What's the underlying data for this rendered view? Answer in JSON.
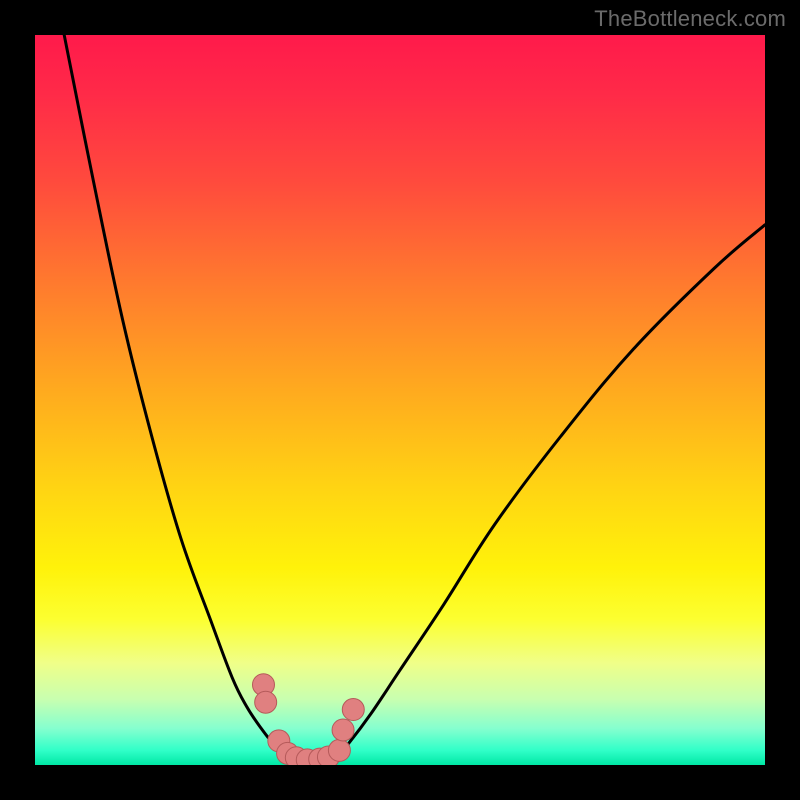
{
  "watermark": "TheBottleneck.com",
  "colors": {
    "background": "#000000",
    "marker_fill": "#e08080",
    "marker_stroke": "#b55a5a",
    "curve_stroke": "#000000"
  },
  "chart_data": {
    "type": "line",
    "title": "",
    "xlabel": "",
    "ylabel": "",
    "xlim": [
      0,
      100
    ],
    "ylim": [
      0,
      100
    ],
    "grid": false,
    "legend": false,
    "series": [
      {
        "name": "left-curve",
        "x": [
          4,
          8,
          12,
          16,
          20,
          24,
          27,
          29,
          31,
          33,
          34.8
        ],
        "values": [
          100,
          80,
          61,
          45,
          31,
          20,
          12,
          8,
          5,
          2.5,
          1.0
        ]
      },
      {
        "name": "right-curve",
        "x": [
          41.2,
          43,
          46,
          50,
          56,
          63,
          72,
          82,
          93,
          100
        ],
        "values": [
          1.0,
          3,
          7,
          13,
          22,
          33,
          45,
          57,
          68,
          74
        ]
      },
      {
        "name": "valley-floor",
        "x": [
          34.8,
          36,
          37.5,
          39,
          40,
          41.2
        ],
        "values": [
          1.0,
          0.6,
          0.5,
          0.5,
          0.7,
          1.0
        ]
      }
    ],
    "markers": {
      "name": "bottleneck-points",
      "x": [
        31.3,
        31.6,
        33.4,
        34.6,
        35.8,
        37.3,
        39.0,
        40.2,
        41.7,
        42.2,
        43.6
      ],
      "y": [
        11.0,
        8.6,
        3.3,
        1.6,
        1.0,
        0.7,
        0.8,
        1.1,
        2.0,
        4.8,
        7.6
      ],
      "size": [
        11,
        11,
        11,
        11,
        11,
        11,
        11,
        11,
        11,
        11,
        11
      ]
    }
  }
}
